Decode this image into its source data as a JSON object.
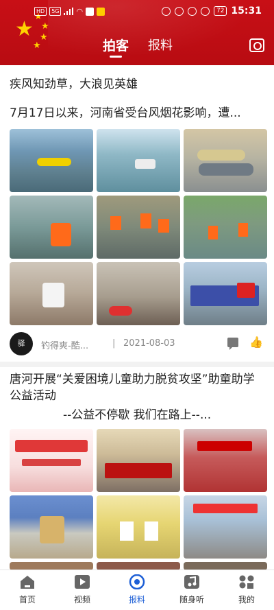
{
  "status_bar": {
    "left_badges": [
      "HD",
      "5G"
    ],
    "battery": "72",
    "time": "15:31"
  },
  "header": {
    "tabs": [
      {
        "label": "拍客",
        "active": true
      },
      {
        "label": "报料",
        "active": false
      }
    ],
    "camera_icon": "camera-icon",
    "accent_color": "#c80f16"
  },
  "feed": {
    "posts": [
      {
        "title": "疾风知劲草，大浪见英雄",
        "subtitle": "7月17日以来，河南省受台风烟花影响，遭...",
        "images": [
          "flood-rescue-boat-photo",
          "flooded-street-car-photo",
          "rubber-boats-trailer-photo",
          "rescuer-with-child-photo",
          "rescue-boat-crowd-photo",
          "wading-rescuers-photo",
          "volunteers-with-child-photo",
          "food-distribution-photo",
          "supply-truck-photo"
        ],
        "author": "钓得爽-酷...",
        "avatar_text": "驿",
        "date": "2021-08-03"
      },
      {
        "title": "唐河开展“关爱困境儿童助力脱贫攻坚”助童助学公益活动",
        "subtitle": "--公益不停歇  我们在路上--...",
        "images": [
          "event-banner-photo",
          "meeting-room-photo",
          "group-photo-volunteers",
          "speaker-podium-photo",
          "children-with-certificates-photo",
          "children-group-photo"
        ]
      }
    ]
  },
  "bottom_nav": {
    "items": [
      {
        "label": "首页",
        "icon": "home-icon",
        "active": false
      },
      {
        "label": "视频",
        "icon": "video-icon",
        "active": false
      },
      {
        "label": "报料",
        "icon": "report-icon",
        "active": true
      },
      {
        "label": "随身听",
        "icon": "music-icon",
        "active": false
      },
      {
        "label": "我的",
        "icon": "profile-icon",
        "active": false
      }
    ],
    "active_color": "#1d5fd6"
  }
}
